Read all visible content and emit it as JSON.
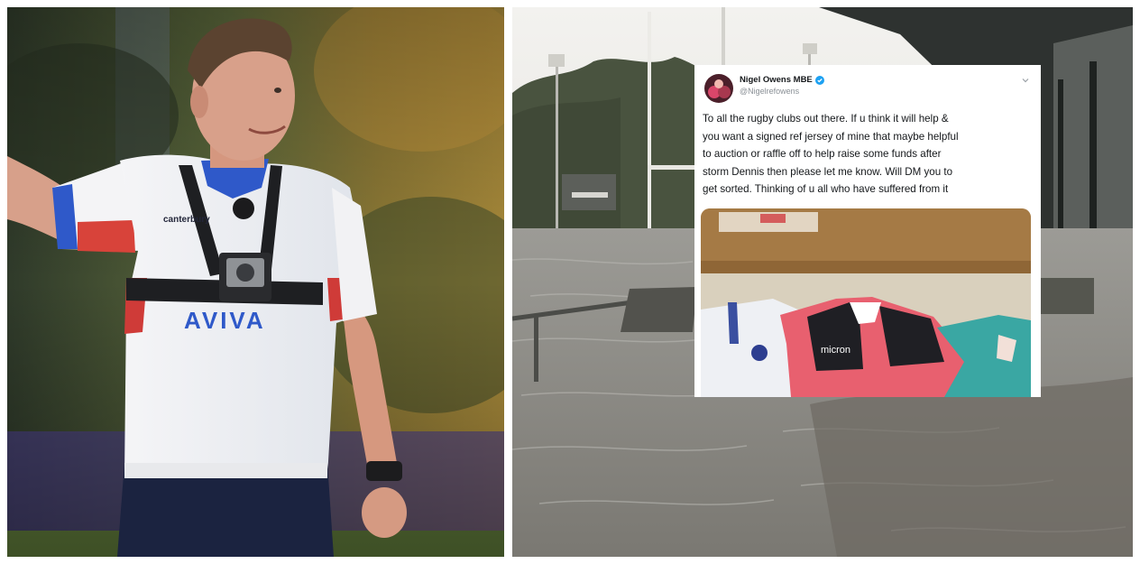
{
  "left_photo": {
    "sponsor_text": "AVIVA",
    "brand_text": "canterbury"
  },
  "tweet": {
    "author_name": "Nigel Owens MBE",
    "author_handle": "@Nigelrefowens",
    "text_lines": [
      "To all the rugby clubs out there. If u think it will help &",
      "you want a signed ref jersey of mine that maybe helpful",
      "to auction or raffle off to help raise some funds after",
      "storm Dennis then please let me know. Will DM you to",
      "get sorted. Thinking of u all who have suffered from it"
    ],
    "media_jersey_text": "micron",
    "icons": {
      "verified": "verified-badge-icon",
      "menu": "chevron-down-icon"
    }
  },
  "colors": {
    "verified_blue": "#1da1f2",
    "jersey_pink": "#e8606f",
    "jersey_teal": "#3aa7a3",
    "flood_grey": "#8d8d88"
  }
}
